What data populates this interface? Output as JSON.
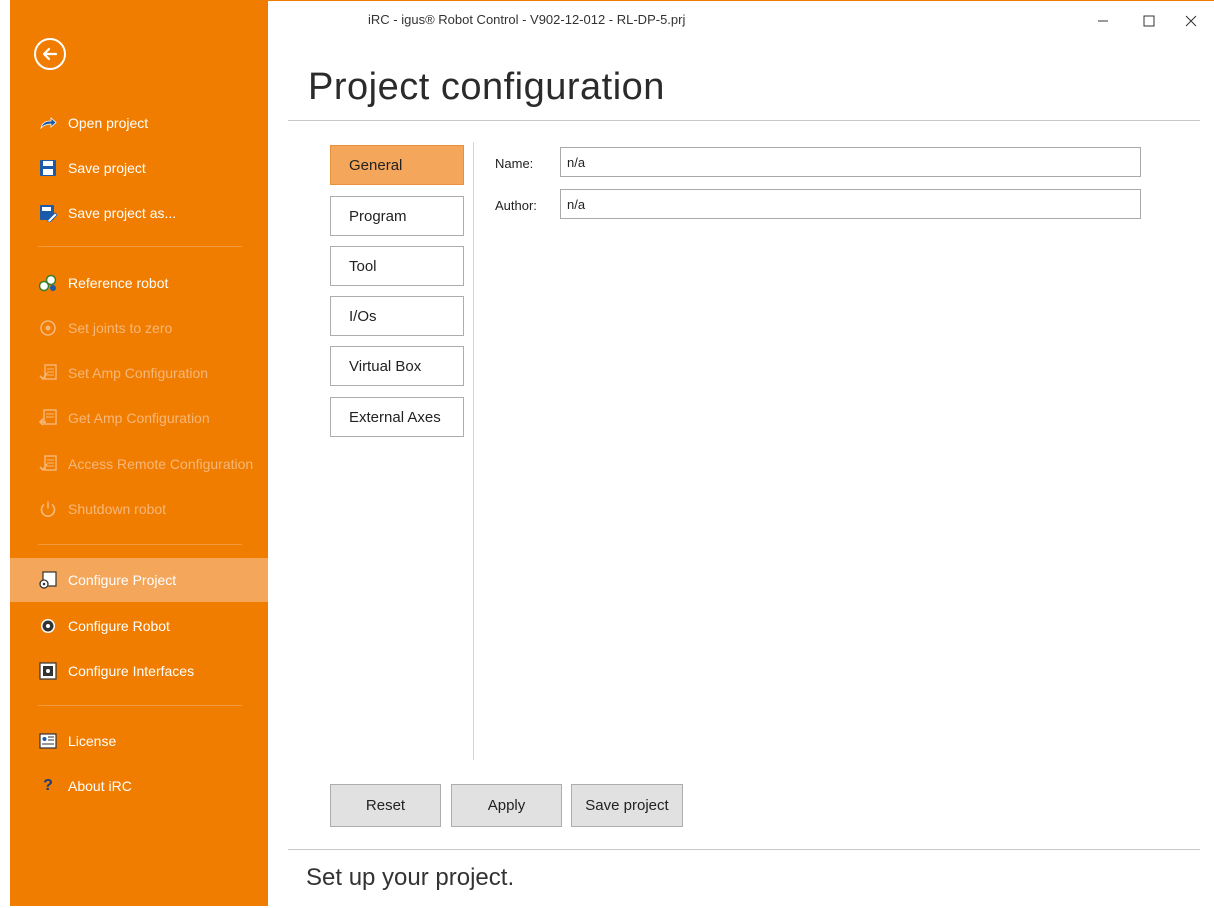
{
  "window": {
    "title": "iRC - igus® Robot Control - V902-12-012 - RL-DP-5.prj"
  },
  "sidebar": {
    "back_icon": "arrow-left-circle-icon",
    "items": [
      {
        "label": "Open project",
        "icon": "open-arrow-icon",
        "enabled": true
      },
      {
        "label": "Save project",
        "icon": "floppy-disk-icon",
        "enabled": true
      },
      {
        "label": "Save project as...",
        "icon": "floppy-edit-icon",
        "enabled": true
      },
      {
        "label": "Reference robot",
        "icon": "reference-gears-icon",
        "enabled": true
      },
      {
        "label": "Set joints to zero",
        "icon": "zero-joint-icon",
        "enabled": false
      },
      {
        "label": "Set Amp Configuration",
        "icon": "amp-config-set-icon",
        "enabled": false
      },
      {
        "label": "Get Amp Configuration",
        "icon": "amp-config-get-icon",
        "enabled": false
      },
      {
        "label": "Access Remote Configuration",
        "icon": "remote-config-icon",
        "enabled": false
      },
      {
        "label": "Shutdown robot",
        "icon": "power-icon",
        "enabled": false
      },
      {
        "label": "Configure Project",
        "icon": "project-config-icon",
        "enabled": true,
        "active": true
      },
      {
        "label": "Configure Robot",
        "icon": "gear-icon",
        "enabled": true
      },
      {
        "label": "Configure Interfaces",
        "icon": "interfaces-icon",
        "enabled": true
      },
      {
        "label": "License",
        "icon": "license-icon",
        "enabled": true
      },
      {
        "label": "About iRC",
        "icon": "question-icon",
        "enabled": true
      }
    ]
  },
  "main": {
    "title": "Project configuration",
    "tabs": [
      {
        "label": "General",
        "active": true
      },
      {
        "label": "Program"
      },
      {
        "label": "Tool"
      },
      {
        "label": "I/Os"
      },
      {
        "label": "Virtual Box"
      },
      {
        "label": "External Axes"
      }
    ],
    "fields": {
      "name_label": "Name:",
      "name_value": "n/a",
      "author_label": "Author:",
      "author_value": "n/a"
    },
    "buttons": {
      "reset": "Reset",
      "apply": "Apply",
      "save": "Save project"
    },
    "footer": "Set up your project."
  },
  "colors": {
    "accent": "#f07d00",
    "active": "#f4a65b",
    "disabled_text": "#f6b77a"
  }
}
